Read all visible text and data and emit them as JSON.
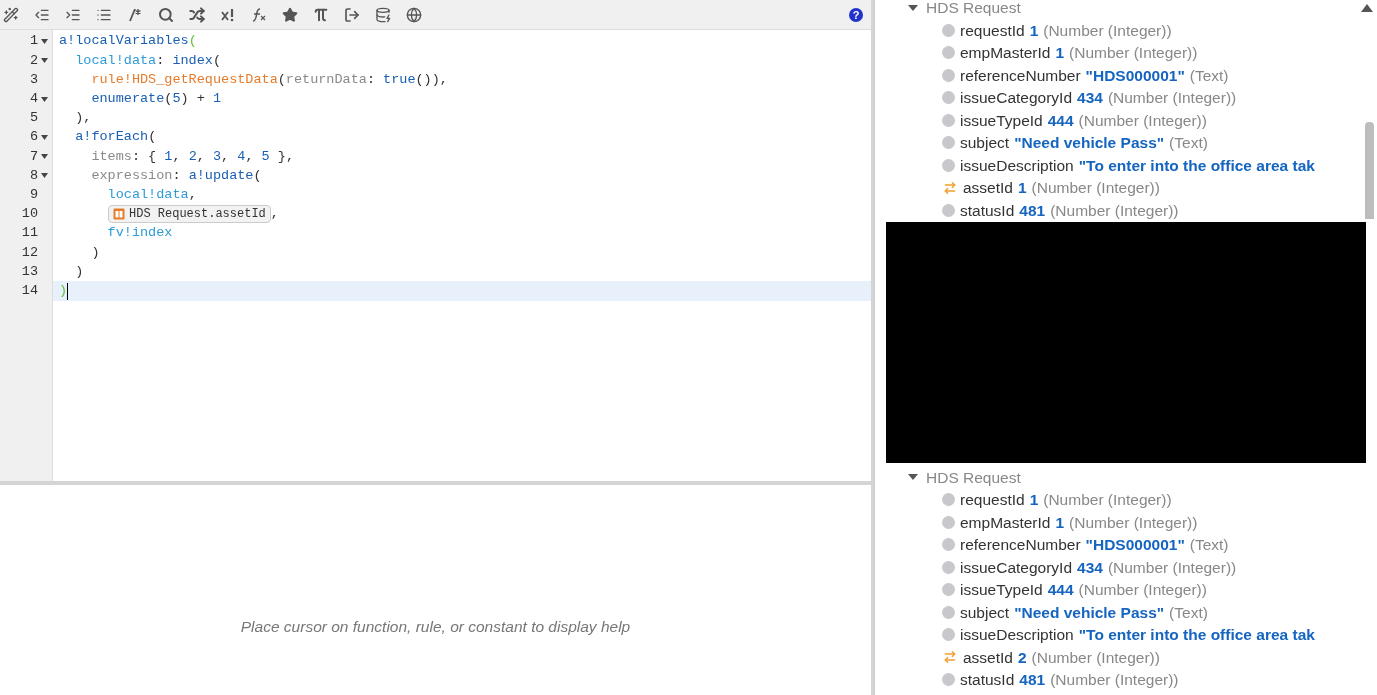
{
  "toolbar": {
    "tools": [
      {
        "kind": "magic-wand"
      },
      {
        "kind": "outdent"
      },
      {
        "kind": "indent"
      },
      {
        "kind": "format"
      },
      {
        "kind": "comment"
      },
      {
        "kind": "search"
      },
      {
        "kind": "shuffle"
      },
      {
        "kind": "exclaim"
      },
      {
        "kind": "function"
      },
      {
        "kind": "star"
      },
      {
        "kind": "pi"
      },
      {
        "kind": "export"
      },
      {
        "kind": "database-search"
      },
      {
        "kind": "globe"
      }
    ],
    "help": "?"
  },
  "editor": {
    "lines": [
      {
        "number": "1",
        "foldable": true,
        "current": false,
        "tokens": [
          {
            "kind": "fn",
            "text": "a!localVariables"
          },
          {
            "kind": "match",
            "text": "("
          }
        ]
      },
      {
        "number": "2",
        "foldable": true,
        "current": false,
        "tokens": [
          {
            "kind": "var",
            "text": "  local!data"
          },
          {
            "kind": "punct",
            "text": ": "
          },
          {
            "kind": "fn",
            "text": "index"
          },
          {
            "kind": "punct",
            "text": "("
          }
        ]
      },
      {
        "number": "3",
        "foldable": false,
        "current": false,
        "tokens": [
          {
            "kind": "rule",
            "text": "    rule!HDS_getRequestData"
          },
          {
            "kind": "punct",
            "text": "("
          },
          {
            "kind": "param",
            "text": "returnData"
          },
          {
            "kind": "punct",
            "text": ": "
          },
          {
            "kind": "fn",
            "text": "true"
          },
          {
            "kind": "punct",
            "text": "()),"
          }
        ]
      },
      {
        "number": "4",
        "foldable": true,
        "current": false,
        "tokens": [
          {
            "kind": "fn",
            "text": "    enumerate"
          },
          {
            "kind": "punct",
            "text": "("
          },
          {
            "kind": "num",
            "text": "5"
          },
          {
            "kind": "punct",
            "text": ") + "
          },
          {
            "kind": "num",
            "text": "1"
          }
        ]
      },
      {
        "number": "5",
        "foldable": false,
        "current": false,
        "tokens": [
          {
            "kind": "punct",
            "text": "  ),"
          }
        ]
      },
      {
        "number": "6",
        "foldable": true,
        "current": false,
        "tokens": [
          {
            "kind": "fn",
            "text": "  a!forEach"
          },
          {
            "kind": "punct",
            "text": "("
          }
        ]
      },
      {
        "number": "7",
        "foldable": true,
        "current": false,
        "tokens": [
          {
            "kind": "param",
            "text": "    items"
          },
          {
            "kind": "punct",
            "text": ": { "
          },
          {
            "kind": "num",
            "text": "1"
          },
          {
            "kind": "punct",
            "text": ", "
          },
          {
            "kind": "num",
            "text": "2"
          },
          {
            "kind": "punct",
            "text": ", "
          },
          {
            "kind": "num",
            "text": "3"
          },
          {
            "kind": "punct",
            "text": ", "
          },
          {
            "kind": "num",
            "text": "4"
          },
          {
            "kind": "punct",
            "text": ", "
          },
          {
            "kind": "num",
            "text": "5"
          },
          {
            "kind": "punct",
            "text": " },"
          }
        ]
      },
      {
        "number": "8",
        "foldable": true,
        "current": false,
        "tokens": [
          {
            "kind": "param",
            "text": "    expression"
          },
          {
            "kind": "punct",
            "text": ": "
          },
          {
            "kind": "fn",
            "text": "a!update"
          },
          {
            "kind": "punct",
            "text": "("
          }
        ]
      },
      {
        "number": "9",
        "foldable": false,
        "current": false,
        "tokens": [
          {
            "kind": "var",
            "text": "      local!data"
          },
          {
            "kind": "punct",
            "text": ","
          }
        ]
      },
      {
        "number": "10",
        "foldable": false,
        "current": false,
        "tokens": [
          {
            "kind": "chip",
            "text": "HDS Request.assetId"
          },
          {
            "kind": "punct",
            "text": ","
          }
        ]
      },
      {
        "number": "11",
        "foldable": false,
        "current": false,
        "tokens": [
          {
            "kind": "var",
            "text": "      fv!index"
          }
        ]
      },
      {
        "number": "12",
        "foldable": false,
        "current": false,
        "tokens": [
          {
            "kind": "punct",
            "text": "    )"
          }
        ]
      },
      {
        "number": "13",
        "foldable": false,
        "current": false,
        "tokens": [
          {
            "kind": "punct",
            "text": "  )"
          }
        ]
      },
      {
        "number": "14",
        "foldable": false,
        "current": true,
        "tokens": [
          {
            "kind": "match",
            "text": ")"
          }
        ]
      }
    ]
  },
  "help_pane": {
    "message": "Place cursor on function, rule, or constant to display help"
  },
  "results": {
    "groups": [
      {
        "title": "HDS Request",
        "expanded": true,
        "fields": [
          {
            "kind": "plain",
            "name": "requestId",
            "value": "1",
            "type": "(Number (Integer))"
          },
          {
            "kind": "plain",
            "name": "empMasterId",
            "value": "1",
            "type": "(Number (Integer))"
          },
          {
            "kind": "plain",
            "name": "referenceNumber",
            "value": "\"HDS000001\"",
            "type": "(Text)"
          },
          {
            "kind": "plain",
            "name": "issueCategoryId",
            "value": "434",
            "type": "(Number (Integer))"
          },
          {
            "kind": "plain",
            "name": "issueTypeId",
            "value": "444",
            "type": "(Number (Integer))"
          },
          {
            "kind": "plain",
            "name": "subject",
            "value": "\"Need vehicle Pass\"",
            "type": "(Text)"
          },
          {
            "kind": "plain",
            "name": "issueDescription",
            "value": "\"To enter into the office area tak"
          },
          {
            "kind": "changed",
            "name": "assetId",
            "value": "1",
            "type": "(Number (Integer))"
          },
          {
            "kind": "plain",
            "name": "statusId",
            "value": "481",
            "type": "(Number (Integer))"
          }
        ]
      },
      {
        "title": "HDS Request",
        "expanded": true,
        "fields": [
          {
            "kind": "plain",
            "name": "requestId",
            "value": "1",
            "type": "(Number (Integer))"
          },
          {
            "kind": "plain",
            "name": "empMasterId",
            "value": "1",
            "type": "(Number (Integer))"
          },
          {
            "kind": "plain",
            "name": "referenceNumber",
            "value": "\"HDS000001\"",
            "type": "(Text)"
          },
          {
            "kind": "plain",
            "name": "issueCategoryId",
            "value": "434",
            "type": "(Number (Integer))"
          },
          {
            "kind": "plain",
            "name": "issueTypeId",
            "value": "444",
            "type": "(Number (Integer))"
          },
          {
            "kind": "plain",
            "name": "subject",
            "value": "\"Need vehicle Pass\"",
            "type": "(Text)"
          },
          {
            "kind": "plain",
            "name": "issueDescription",
            "value": "\"To enter into the office area tak"
          },
          {
            "kind": "changed",
            "name": "assetId",
            "value": "2",
            "type": "(Number (Integer))"
          },
          {
            "kind": "plain",
            "name": "statusId",
            "value": "481",
            "type": "(Number (Integer))"
          }
        ]
      }
    ]
  }
}
